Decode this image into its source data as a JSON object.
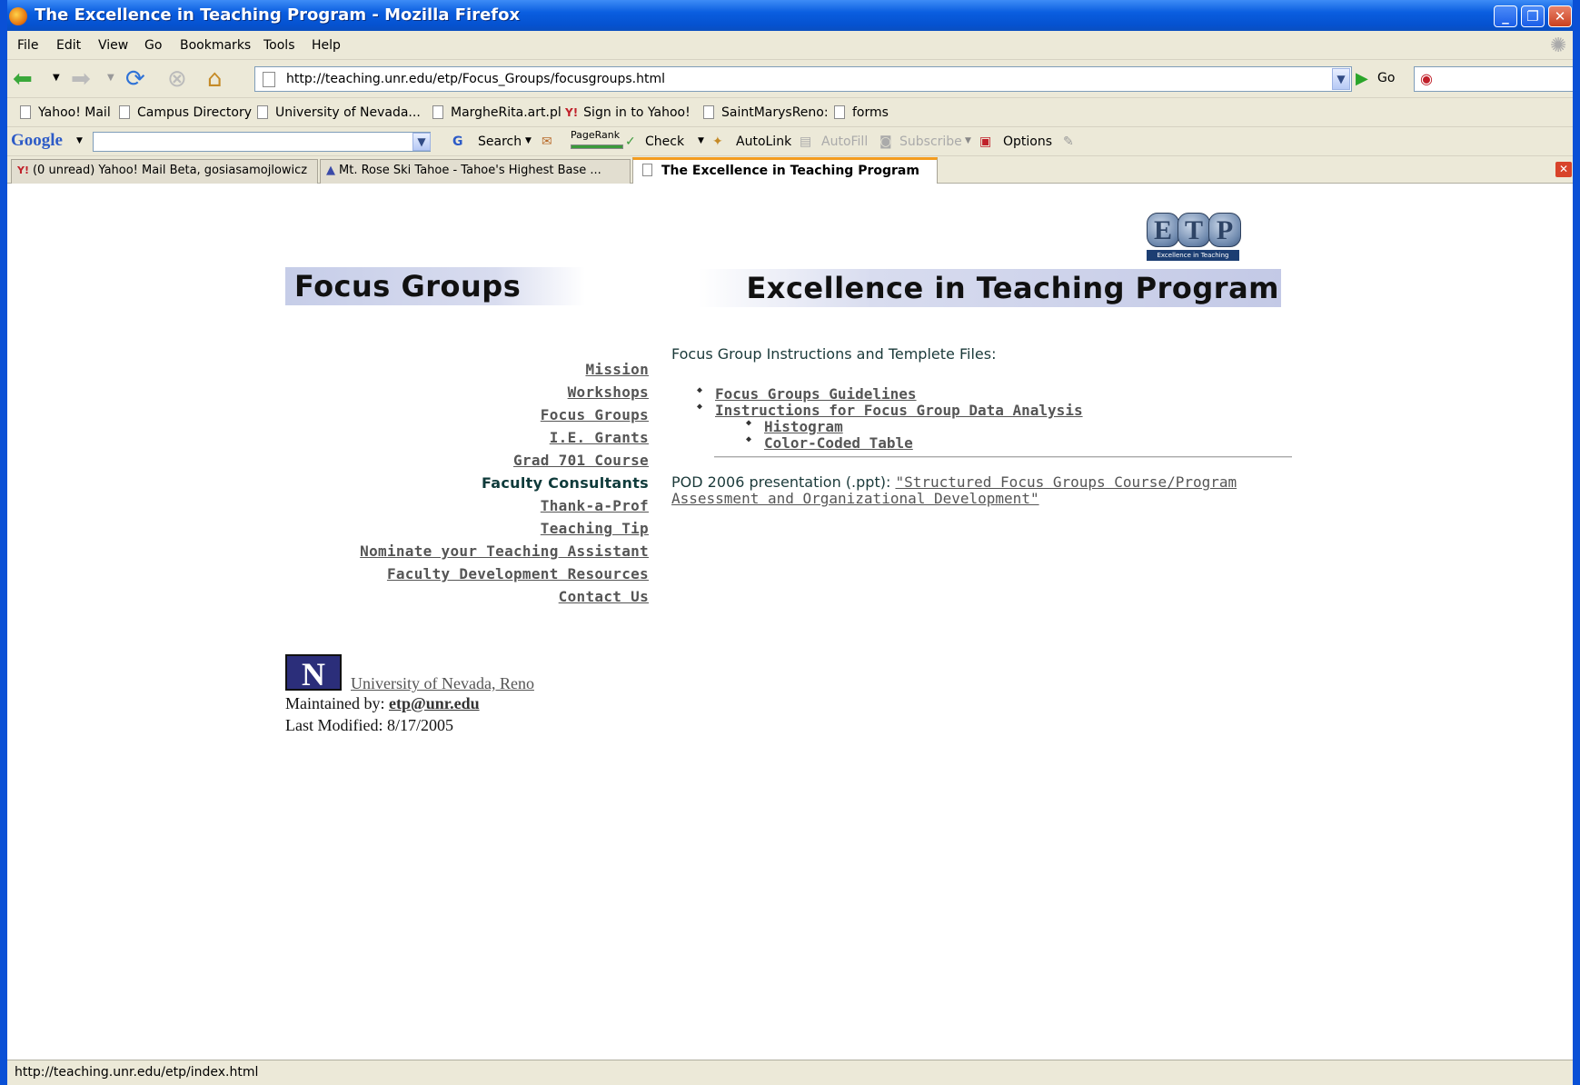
{
  "window": {
    "title": "The Excellence in Teaching Program - Mozilla Firefox"
  },
  "menu": [
    "File",
    "Edit",
    "View",
    "Go",
    "Bookmarks",
    "Tools",
    "Help"
  ],
  "nav": {
    "url": "http://teaching.unr.edu/etp/Focus_Groups/focusgroups.html",
    "go_label": "Go"
  },
  "bookmarks": [
    "Yahoo! Mail",
    "Campus Directory",
    "University of Nevada...",
    "MargheRita.art.pl",
    "Sign in to Yahoo!",
    "SaintMarysReno:",
    "forms"
  ],
  "google_toolbar": {
    "logo": "Google",
    "search_label": "Search",
    "pagerank_label": "PageRank",
    "check_label": "Check",
    "autolink_label": "AutoLink",
    "autofill_label": "AutoFill",
    "subscribe_label": "Subscribe",
    "options_label": "Options"
  },
  "tabs": [
    "(0 unread) Yahoo! Mail Beta, gosiasamojlowicz",
    "Mt. Rose Ski Tahoe - Tahoe's Highest Base ...",
    "The Excellence in Teaching Program"
  ],
  "page": {
    "logo_letters": [
      "E",
      "T",
      "P"
    ],
    "logo_caption": "Excellence in Teaching Program",
    "banner_left": "Focus Groups",
    "banner_right": "Excellence in Teaching Program",
    "nav_links": [
      "Mission",
      "Workshops",
      "Focus Groups",
      "I.E. Grants",
      "Grad 701 Course",
      "Faculty Consultants",
      "Thank-a-Prof",
      "Teaching Tip",
      "Nominate your Teaching Assistant",
      "Faculty Development Resources",
      "Contact Us"
    ],
    "intro": "Focus Group Instructions and Templete Files:",
    "files": [
      "Focus Groups Guidelines",
      "Instructions for Focus Group Data Analysis",
      "Histogram",
      "Color-Coded Table"
    ],
    "pod_prefix": "POD 2006 presentation (.ppt): ",
    "pod_link": "\"Structured Focus Groups Course/Program Assessment and Organizational Development\"",
    "univ_logo_text": "N",
    "univ_link": "University of Nevada, Reno",
    "maintained_label": "Maintained by: ",
    "maintained_email": "etp@unr.edu",
    "last_modified": "Last Modified: 8/17/2005"
  },
  "status": "http://teaching.unr.edu/etp/index.html"
}
